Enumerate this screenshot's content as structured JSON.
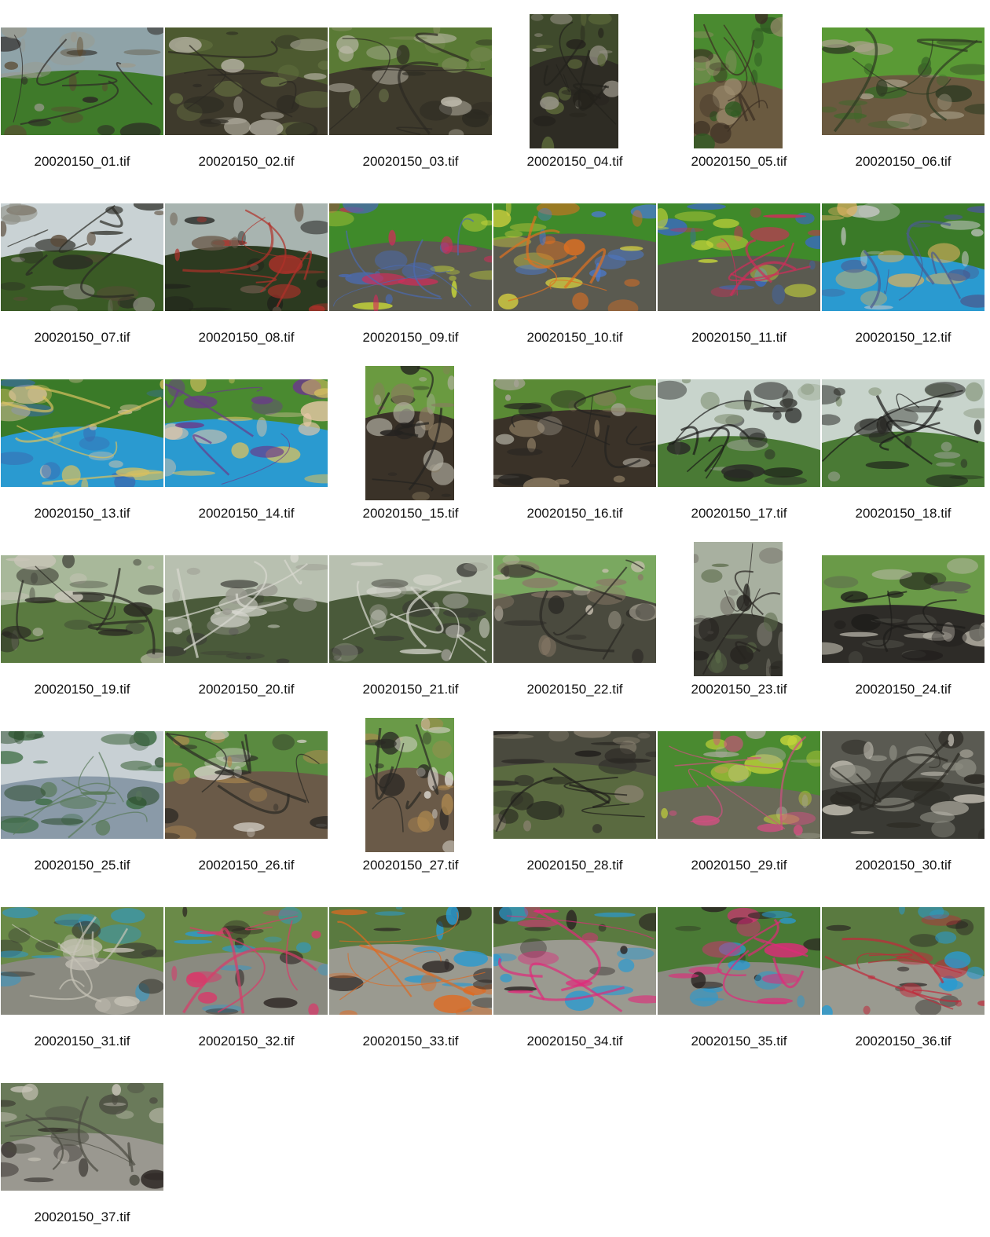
{
  "contact_sheet": {
    "thumbnails": [
      {
        "filename": "20020150_01.tif",
        "orientation": "landscape",
        "palette": [
          "#8fa3a8",
          "#3f7a2a",
          "#5a4a32",
          "#9a9a8e",
          "#2d2a26"
        ]
      },
      {
        "filename": "20020150_02.tif",
        "orientation": "landscape",
        "palette": [
          "#4d5a30",
          "#3e3a2c",
          "#6b7a45",
          "#b8b4a6",
          "#2c2a22"
        ]
      },
      {
        "filename": "20020150_03.tif",
        "orientation": "landscape",
        "palette": [
          "#5a7a35",
          "#3e3a2c",
          "#7a8a55",
          "#c2beb0",
          "#2c2a22"
        ]
      },
      {
        "filename": "20020150_04.tif",
        "orientation": "portrait",
        "palette": [
          "#3f4a2c",
          "#2e2c24",
          "#5d6a3a",
          "#9a968a",
          "#24221c"
        ]
      },
      {
        "filename": "20020150_05.tif",
        "orientation": "portrait",
        "palette": [
          "#4a8a30",
          "#6a5a40",
          "#2f5a22",
          "#9e8e70",
          "#3a2e22"
        ]
      },
      {
        "filename": "20020150_06.tif",
        "orientation": "landscape",
        "palette": [
          "#5a9a35",
          "#6a5a40",
          "#3a6a28",
          "#a8a08a",
          "#2e3a22"
        ]
      },
      {
        "filename": "20020150_07.tif",
        "orientation": "landscape",
        "palette": [
          "#c9d2d4",
          "#3a5a25",
          "#5a4a38",
          "#8a8a80",
          "#2a2a24"
        ]
      },
      {
        "filename": "20020150_08.tif",
        "orientation": "landscape",
        "palette": [
          "#a8b4b0",
          "#2c3a20",
          "#1e1e1a",
          "#6a5a4a",
          "#b0302a"
        ]
      },
      {
        "filename": "20020150_09.tif",
        "orientation": "landscape",
        "palette": [
          "#3f8a2a",
          "#5a5a50",
          "#d02c5a",
          "#c4d43a",
          "#4a6ab0"
        ]
      },
      {
        "filename": "20020150_10.tif",
        "orientation": "landscape",
        "palette": [
          "#3f8a2a",
          "#5a5a50",
          "#4a7ad0",
          "#d6d040",
          "#e07020"
        ]
      },
      {
        "filename": "20020150_11.tif",
        "orientation": "landscape",
        "palette": [
          "#3f8a2a",
          "#5a5a50",
          "#3a6ac0",
          "#c4d43a",
          "#d02c5a"
        ]
      },
      {
        "filename": "20020150_12.tif",
        "orientation": "landscape",
        "palette": [
          "#3a7a28",
          "#2a9ad0",
          "#c8c8c8",
          "#d8b060",
          "#4a5a90"
        ]
      },
      {
        "filename": "20020150_13.tif",
        "orientation": "landscape",
        "palette": [
          "#3a7a28",
          "#2a9ad0",
          "#e8c8a8",
          "#3a6ab0",
          "#d8c060"
        ]
      },
      {
        "filename": "20020150_14.tif",
        "orientation": "landscape",
        "palette": [
          "#4a8a30",
          "#2a9ad0",
          "#e8c8a8",
          "#d8c060",
          "#6a3a8a"
        ]
      },
      {
        "filename": "20020150_15.tif",
        "orientation": "portrait",
        "palette": [
          "#6a9a40",
          "#3a3228",
          "#8a7a60",
          "#b8b4a8",
          "#242220"
        ]
      },
      {
        "filename": "20020150_16.tif",
        "orientation": "landscape",
        "palette": [
          "#5a8a35",
          "#3a3228",
          "#8a7a60",
          "#a8a498",
          "#242220"
        ]
      },
      {
        "filename": "20020150_17.tif",
        "orientation": "landscape",
        "palette": [
          "#c8d4cc",
          "#4a7a35",
          "#2a2a26",
          "#8a9a80",
          "#1a1a18"
        ]
      },
      {
        "filename": "20020150_18.tif",
        "orientation": "landscape",
        "palette": [
          "#c8d4cc",
          "#4a7a35",
          "#2a2a26",
          "#8a9a80",
          "#1a1a18"
        ]
      },
      {
        "filename": "20020150_19.tif",
        "orientation": "landscape",
        "palette": [
          "#a8b89a",
          "#5a7a40",
          "#3a3a32",
          "#c8c4b8",
          "#2a2822"
        ]
      },
      {
        "filename": "20020150_20.tif",
        "orientation": "landscape",
        "palette": [
          "#b8c0b0",
          "#4a5a3a",
          "#3a3a34",
          "#9a9a90",
          "#d8d8d0"
        ]
      },
      {
        "filename": "20020150_21.tif",
        "orientation": "landscape",
        "palette": [
          "#b8c0b0",
          "#4a5a3a",
          "#3a3a34",
          "#9a9a90",
          "#d8d8d0"
        ]
      },
      {
        "filename": "20020150_22.tif",
        "orientation": "landscape",
        "palette": [
          "#7aa860",
          "#4a4a3e",
          "#8a7a68",
          "#c8c0b0",
          "#2a2824"
        ]
      },
      {
        "filename": "20020150_23.tif",
        "orientation": "portrait",
        "palette": [
          "#a8b0a0",
          "#3a3a32",
          "#5a6a48",
          "#7a786e",
          "#262420"
        ]
      },
      {
        "filename": "20020150_24.tif",
        "orientation": "landscape",
        "palette": [
          "#6a9a48",
          "#2e2c28",
          "#5a5a52",
          "#c0bcb0",
          "#1e1c1a"
        ]
      },
      {
        "filename": "20020150_25.tif",
        "orientation": "landscape",
        "palette": [
          "#c8d0d4",
          "#8a9aa8",
          "#3a6a40",
          "#2a4a2a",
          "#5a7a5a"
        ]
      },
      {
        "filename": "20020150_26.tif",
        "orientation": "landscape",
        "palette": [
          "#5a8a40",
          "#6a5a48",
          "#b08a50",
          "#d8d4cc",
          "#2a2824"
        ]
      },
      {
        "filename": "20020150_27.tif",
        "orientation": "portrait",
        "palette": [
          "#6a9a48",
          "#6a5a48",
          "#b08a50",
          "#d8d4cc",
          "#2a2824"
        ]
      },
      {
        "filename": "20020150_28.tif",
        "orientation": "landscape",
        "palette": [
          "#4a4a3e",
          "#5a6a40",
          "#2c2a26",
          "#8a8270",
          "#1e1c1a"
        ]
      },
      {
        "filename": "20020150_29.tif",
        "orientation": "landscape",
        "palette": [
          "#4a8a30",
          "#6a6a58",
          "#a8a89a",
          "#c4d43a",
          "#d05080"
        ]
      },
      {
        "filename": "20020150_30.tif",
        "orientation": "landscape",
        "palette": [
          "#5a5a52",
          "#3a3a34",
          "#8a8a80",
          "#c8c4b8",
          "#2a2822"
        ]
      },
      {
        "filename": "20020150_31.tif",
        "orientation": "landscape",
        "palette": [
          "#6a8a48",
          "#8a8a80",
          "#3a3a32",
          "#2a9ad0",
          "#c8c4b8"
        ]
      },
      {
        "filename": "20020150_32.tif",
        "orientation": "landscape",
        "palette": [
          "#6a8a48",
          "#8a8a80",
          "#2a2220",
          "#2a9ad0",
          "#d83a6a"
        ]
      },
      {
        "filename": "20020150_33.tif",
        "orientation": "landscape",
        "palette": [
          "#5a7a40",
          "#9a9a90",
          "#2a2422",
          "#2a9ad0",
          "#e06a20"
        ]
      },
      {
        "filename": "20020150_34.tif",
        "orientation": "landscape",
        "palette": [
          "#5a7a40",
          "#9a9a90",
          "#2a2422",
          "#2a9ad0",
          "#e02a7a"
        ]
      },
      {
        "filename": "20020150_35.tif",
        "orientation": "landscape",
        "palette": [
          "#4a7a35",
          "#8a8a80",
          "#2a2422",
          "#2a9ad0",
          "#e02a7a"
        ]
      },
      {
        "filename": "20020150_36.tif",
        "orientation": "landscape",
        "palette": [
          "#5a7a40",
          "#9a9a90",
          "#2a2422",
          "#2a9ad0",
          "#c02a3a"
        ]
      },
      {
        "filename": "20020150_37.tif",
        "orientation": "landscape",
        "palette": [
          "#6a7a5a",
          "#9a9890",
          "#2a2422",
          "#c8c4b8",
          "#4a4a40"
        ]
      }
    ]
  }
}
